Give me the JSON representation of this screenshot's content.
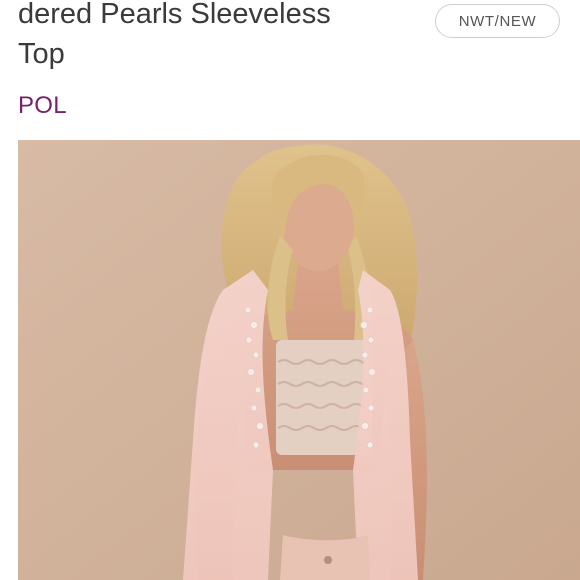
{
  "listing": {
    "title_lines": [
      "dered Pearls Sleeveless",
      "Top"
    ],
    "condition_badge": "NWT/NEW",
    "brand": "POL"
  },
  "colors": {
    "brand": "#7a1f6c",
    "title": "#3a3a3a",
    "badge_border": "#cfcfcf",
    "photo_background": "#d2b39c"
  },
  "icons": {
    "photo": "product-photo"
  }
}
